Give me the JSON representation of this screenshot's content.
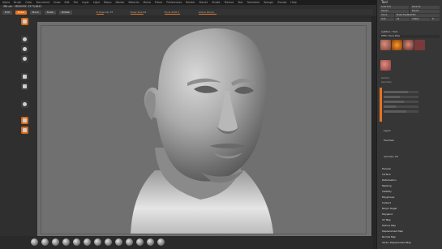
{
  "menubar": {
    "items": [
      "Alpha",
      "Brush",
      "Color",
      "Document",
      "Draw",
      "Edit",
      "File",
      "Layer",
      "Light",
      "Macro",
      "Marker",
      "Material",
      "Movie",
      "Picker",
      "Preferences",
      "Render",
      "Stencil",
      "Stroke",
      "Texture",
      "Tool",
      "Transform",
      "Zplugin",
      "Zscript",
      "Help"
    ]
  },
  "doc": {
    "title": "ZBrush  ·  MEMORY: 2377/4842"
  },
  "toolbar": {
    "edit_label": "Edit",
    "draw_label": "Draw",
    "move_label": "Move",
    "scale_label": "Scale",
    "rotate_label": "Rotate",
    "sliders": [
      {
        "label": "Z Intensity 25",
        "fraction": 0.25
      },
      {
        "label": "Draw Size 64",
        "fraction": 0.42
      },
      {
        "label": "Focal Shift 0",
        "fraction": 0.5
      },
      {
        "label": "Active Points",
        "fraction": 0.6
      }
    ]
  },
  "tool": {
    "title": "Tool",
    "buttons": [
      "Load Tool",
      "Save As",
      "Import",
      "Export",
      "Clone",
      "Make PolyMesh3D",
      "GoZ",
      "All",
      "Visible",
      "R"
    ],
    "lightbox_label": "Lightbox › Tools",
    "current_tool": "PM3D_Head_Male",
    "subtool_label": "SubTool",
    "geometry_label": "Geometry",
    "subtool_items": [
      "Head",
      "Eyes",
      "Teeth"
    ],
    "list": [
      "Preview",
      "Surface",
      "Deformation",
      "Masking",
      "Visibility",
      "Polygroups",
      "Contact",
      "Morph Target",
      "Polypaint",
      "UV Map",
      "Texture Map",
      "Displacement Map",
      "Normal Map",
      "Vector Displacement Map"
    ],
    "highlighted": "Subtool",
    "section_items": [
      "Layers",
      "FiberMesh",
      "Geometry HD"
    ]
  },
  "brushes": [
    "Standard",
    "ClayBuildup",
    "DamStandard",
    "Move",
    "Inflate",
    "Pinch",
    "hPolish",
    "Slash3",
    "TrimDynamic",
    "SnakeHook",
    "Smooth",
    "Dam",
    "Flatten"
  ],
  "colors": {
    "accent": "#e8731f",
    "panel": "#363636",
    "canvas": "#707070"
  }
}
